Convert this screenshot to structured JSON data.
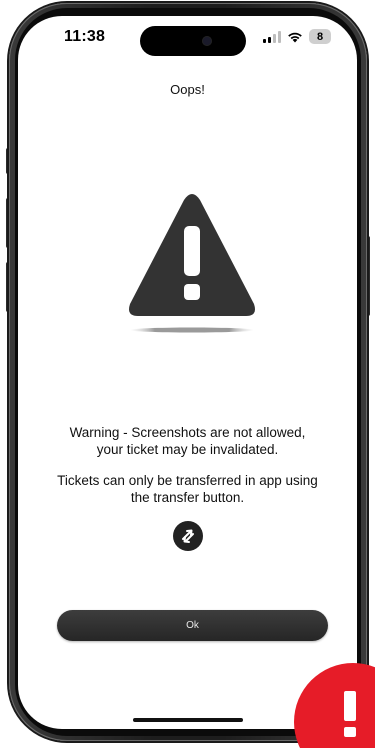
{
  "status_bar": {
    "time": "11:38",
    "battery_level": "8",
    "icons": [
      "signal-icon",
      "wifi-icon",
      "battery-icon"
    ]
  },
  "header": {
    "title": "Oops!"
  },
  "warning": {
    "icon": "warning-triangle-icon",
    "message_line_1": "Warning - Screenshots are not allowed,",
    "message_line_2": "your ticket may be invalidated.",
    "transfer_line_1": "Tickets can only be transferred in app using",
    "transfer_line_2": "the transfer button."
  },
  "transfer_button": {
    "icon": "transfer-arrows-icon"
  },
  "actions": {
    "ok_label": "Ok"
  },
  "overlay_badge": {
    "icon": "exclamation-icon",
    "color": "#e61c28"
  },
  "colors": {
    "button_background": "#2f2f2f",
    "warning_triangle": "#333333",
    "text": "#111111"
  }
}
